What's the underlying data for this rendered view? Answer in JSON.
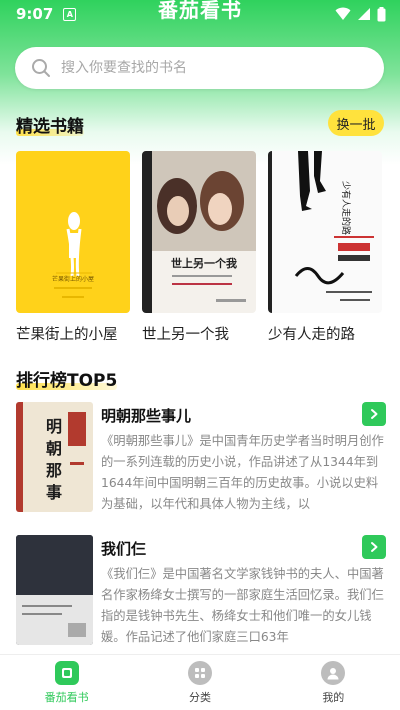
{
  "status": {
    "time": "9:07",
    "a_badge": "A"
  },
  "app": {
    "title": "番茄看书"
  },
  "search": {
    "placeholder": "搜入你要查找的书名"
  },
  "featured": {
    "title": "精选书籍",
    "swap_label": "换一批",
    "books": [
      {
        "name": "芒果街上的小屋",
        "cover_text": "芒果街上的小屋"
      },
      {
        "name": "世上另一个我",
        "cover_text": "世上另一个我"
      },
      {
        "name": "少有人走的路",
        "cover_text": "少有人走的路"
      }
    ]
  },
  "ranking": {
    "title": "排行榜TOP5",
    "items": [
      {
        "title": "明朝那些事儿",
        "cover_text": "明朝那些事儿",
        "desc": "《明朝那些事儿》是中国青年历史学者当时明月创作的一系列连载的历史小说，作品讲述了从1344年到1644年间中国明朝三百年的历史故事。小说以史料为基础，以年代和具体人物为主线，以"
      },
      {
        "title": "我们仨",
        "cover_text": "我们仨",
        "desc": "《我们仨》是中国著名文学家钱钟书的夫人、中国著名作家杨绛女士撰写的一部家庭生活回忆录。我们仨指的是钱钟书先生、杨绛女士和他们唯一的女儿钱媛。作品记述了他们家庭三口63年"
      }
    ]
  },
  "tabs": [
    {
      "label": "番茄看书"
    },
    {
      "label": "分类"
    },
    {
      "label": "我的"
    }
  ],
  "colors": {
    "accent": "#2fc95a",
    "highlight": "#ffe23d"
  }
}
